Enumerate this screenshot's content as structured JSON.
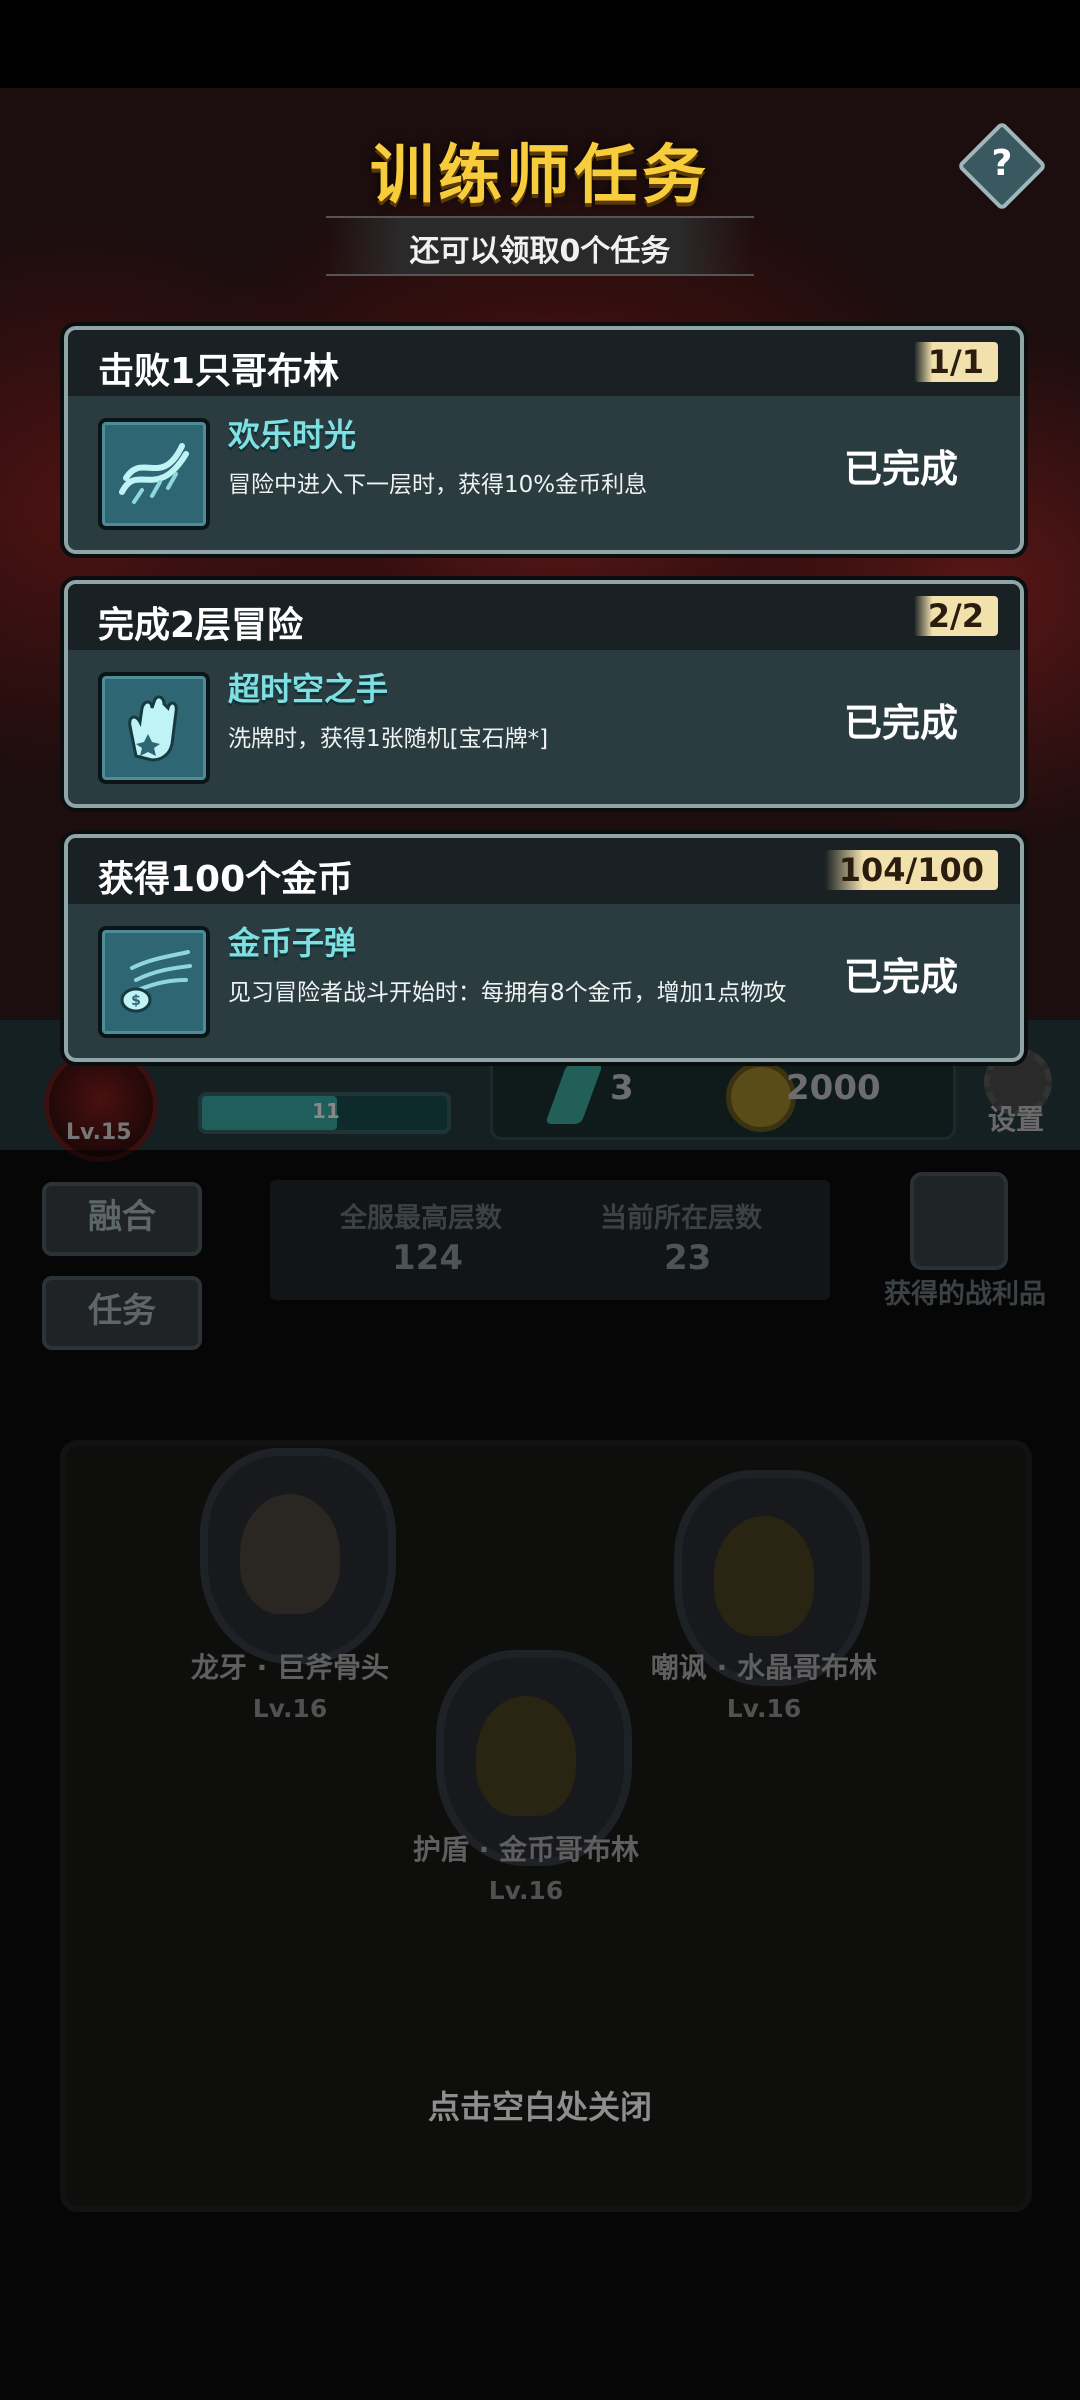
{
  "header": {
    "title": "训练师任务",
    "subtitle": "还可以领取0个任务",
    "help_label": "?"
  },
  "tasks": [
    {
      "title": "击败1只哥布林",
      "progress": "1/1",
      "reward_name": "欢乐时光",
      "reward_desc": "冒险中进入下一层时，获得10%金币利息",
      "status": "已完成",
      "icon": "scroll-icon"
    },
    {
      "title": "完成2层冒险",
      "progress": "2/2",
      "reward_name": "超时空之手",
      "reward_desc": "洗牌时，获得1张随机[宝石牌*]",
      "status": "已完成",
      "icon": "gauntlet-icon"
    },
    {
      "title": "获得100个金币",
      "progress": "104/100",
      "reward_name": "金币子弹",
      "reward_desc": "见习冒险者战斗开始时：每拥有8个金币，增加1点物攻",
      "status": "已完成",
      "icon": "coin-bullet-icon"
    }
  ],
  "hud": {
    "level": "Lv.15",
    "bar_value": "11",
    "crystals": "3",
    "coins": "2000",
    "settings_label": "设置"
  },
  "side_buttons": {
    "fusion": "融合",
    "tasks": "任务"
  },
  "stats": {
    "server_best_label": "全服最高层数",
    "server_best_value": "124",
    "current_label": "当前所在层数",
    "current_value": "23",
    "loot_label": "获得的战利品"
  },
  "units": [
    {
      "name": "龙牙 · 巨斧骨头",
      "level": "Lv.16"
    },
    {
      "name": "嘲讽 · 水晶哥布林",
      "level": "Lv.16"
    },
    {
      "name": "护盾 · 金币哥布林",
      "level": "Lv.16"
    }
  ],
  "close_hint": "点击空白处关闭",
  "colors": {
    "title_gold": "#f8cd3c",
    "reward_name_cyan": "#7fe0e3",
    "card_bg": "#2b3c40",
    "progress_bg": "#f3e1ad"
  }
}
